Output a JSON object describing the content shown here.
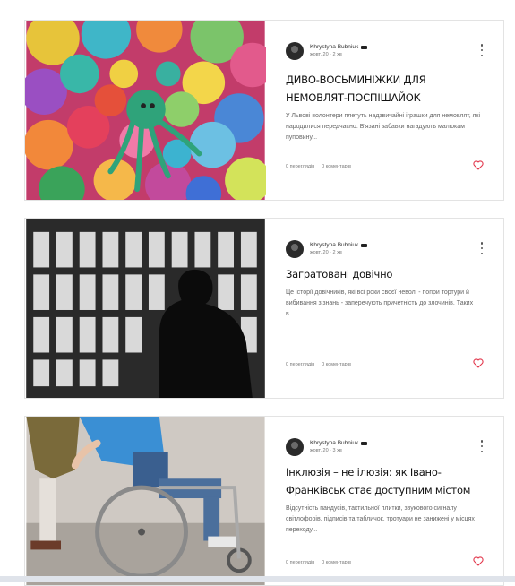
{
  "colors": {
    "accent": "#e2384d",
    "text": "#111111",
    "muted": "#666666"
  },
  "posts": [
    {
      "author": "Khrystyna Bubniuk",
      "date": "жовт. 20 · 2 хв",
      "title": "ДИВО-ВОСЬМИНІЖКИ ДЛЯ НЕМОВЛЯТ-ПОСПІШАЙОК",
      "excerpt": "У Львові волонтери плетуть надзвичайні іграшки для немовлят, які народилися передчасно. В'язані забавки нагадують малюкам пуповину...",
      "views": "0 переглядів",
      "comments": "0 коментарів",
      "image_icon": "crochet-octopus-photo"
    },
    {
      "author": "Khrystyna Bubniuk",
      "date": "жовт. 20 · 2 хв",
      "title": "Загратовані довічно",
      "excerpt": "Це історії довічників, які всі роки своєї неволі - попри тортури й вибивання зізнань - заперечують причетність до злочинів. Таких в...",
      "views": "0 переглядів",
      "comments": "0 коментарів",
      "image_icon": "prison-bars-photo"
    },
    {
      "author": "Khrystyna Bubniuk",
      "date": "жовт. 20 · 3 хв",
      "title": "Інклюзія – не ілюзія: як Івано-Франківськ стає доступним містом",
      "excerpt": "Відсутність пандусів, тактильної плитки, звукового сигналу світлофорів, підписів та табличок, тротуари не занижені у місцях переходу...",
      "views": "0 переглядів",
      "comments": "0 коментарів",
      "image_icon": "wheelchair-photo"
    }
  ]
}
